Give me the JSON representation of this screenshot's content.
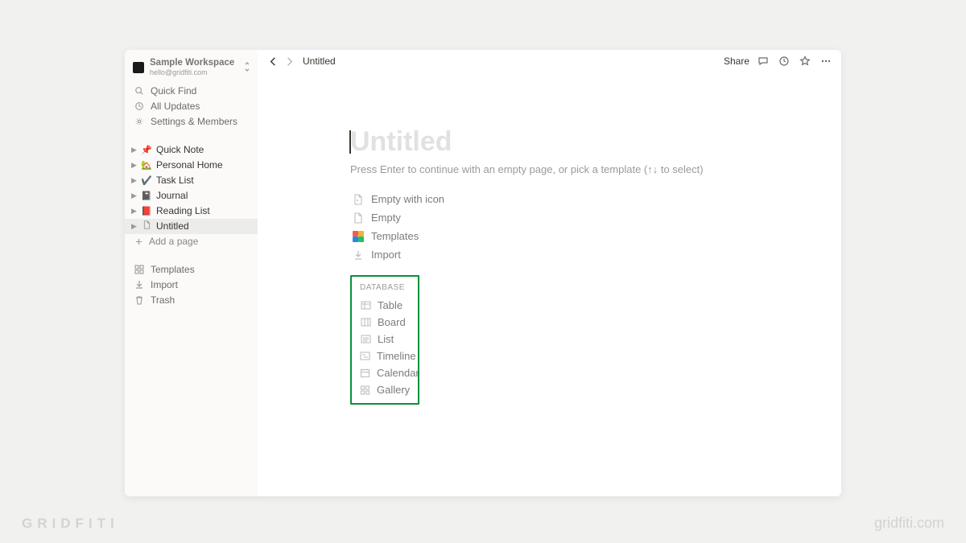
{
  "workspace": {
    "name": "Sample Workspace",
    "email": "hello@gridfiti.com"
  },
  "nav": {
    "quick_find": "Quick Find",
    "all_updates": "All Updates",
    "settings": "Settings & Members"
  },
  "pages": [
    {
      "emoji": "📌",
      "label": "Quick Note"
    },
    {
      "emoji": "🏡",
      "label": "Personal Home"
    },
    {
      "emoji": "✔️",
      "label": "Task List"
    },
    {
      "emoji": "📓",
      "label": "Journal"
    },
    {
      "emoji": "📕",
      "label": "Reading List"
    },
    {
      "emoji": "📄",
      "label": "Untitled",
      "selected": true
    }
  ],
  "add_page": "Add a page",
  "bottom_nav": {
    "templates": "Templates",
    "import": "Import",
    "trash": "Trash"
  },
  "topbar": {
    "title": "Untitled",
    "share": "Share"
  },
  "main": {
    "title_placeholder": "Untitled",
    "hint": "Press Enter to continue with an empty page, or pick a template (↑↓ to select)",
    "templates": [
      {
        "id": "empty-icon",
        "label": "Empty with icon"
      },
      {
        "id": "empty",
        "label": "Empty"
      },
      {
        "id": "templates",
        "label": "Templates"
      },
      {
        "id": "import",
        "label": "Import"
      }
    ],
    "database_header": "DATABASE",
    "database": [
      {
        "id": "table",
        "label": "Table"
      },
      {
        "id": "board",
        "label": "Board"
      },
      {
        "id": "list",
        "label": "List"
      },
      {
        "id": "timeline",
        "label": "Timeline"
      },
      {
        "id": "calendar",
        "label": "Calendar"
      },
      {
        "id": "gallery",
        "label": "Gallery"
      }
    ]
  },
  "watermark": {
    "left": "GRIDFITI",
    "right": "gridfiti.com"
  }
}
